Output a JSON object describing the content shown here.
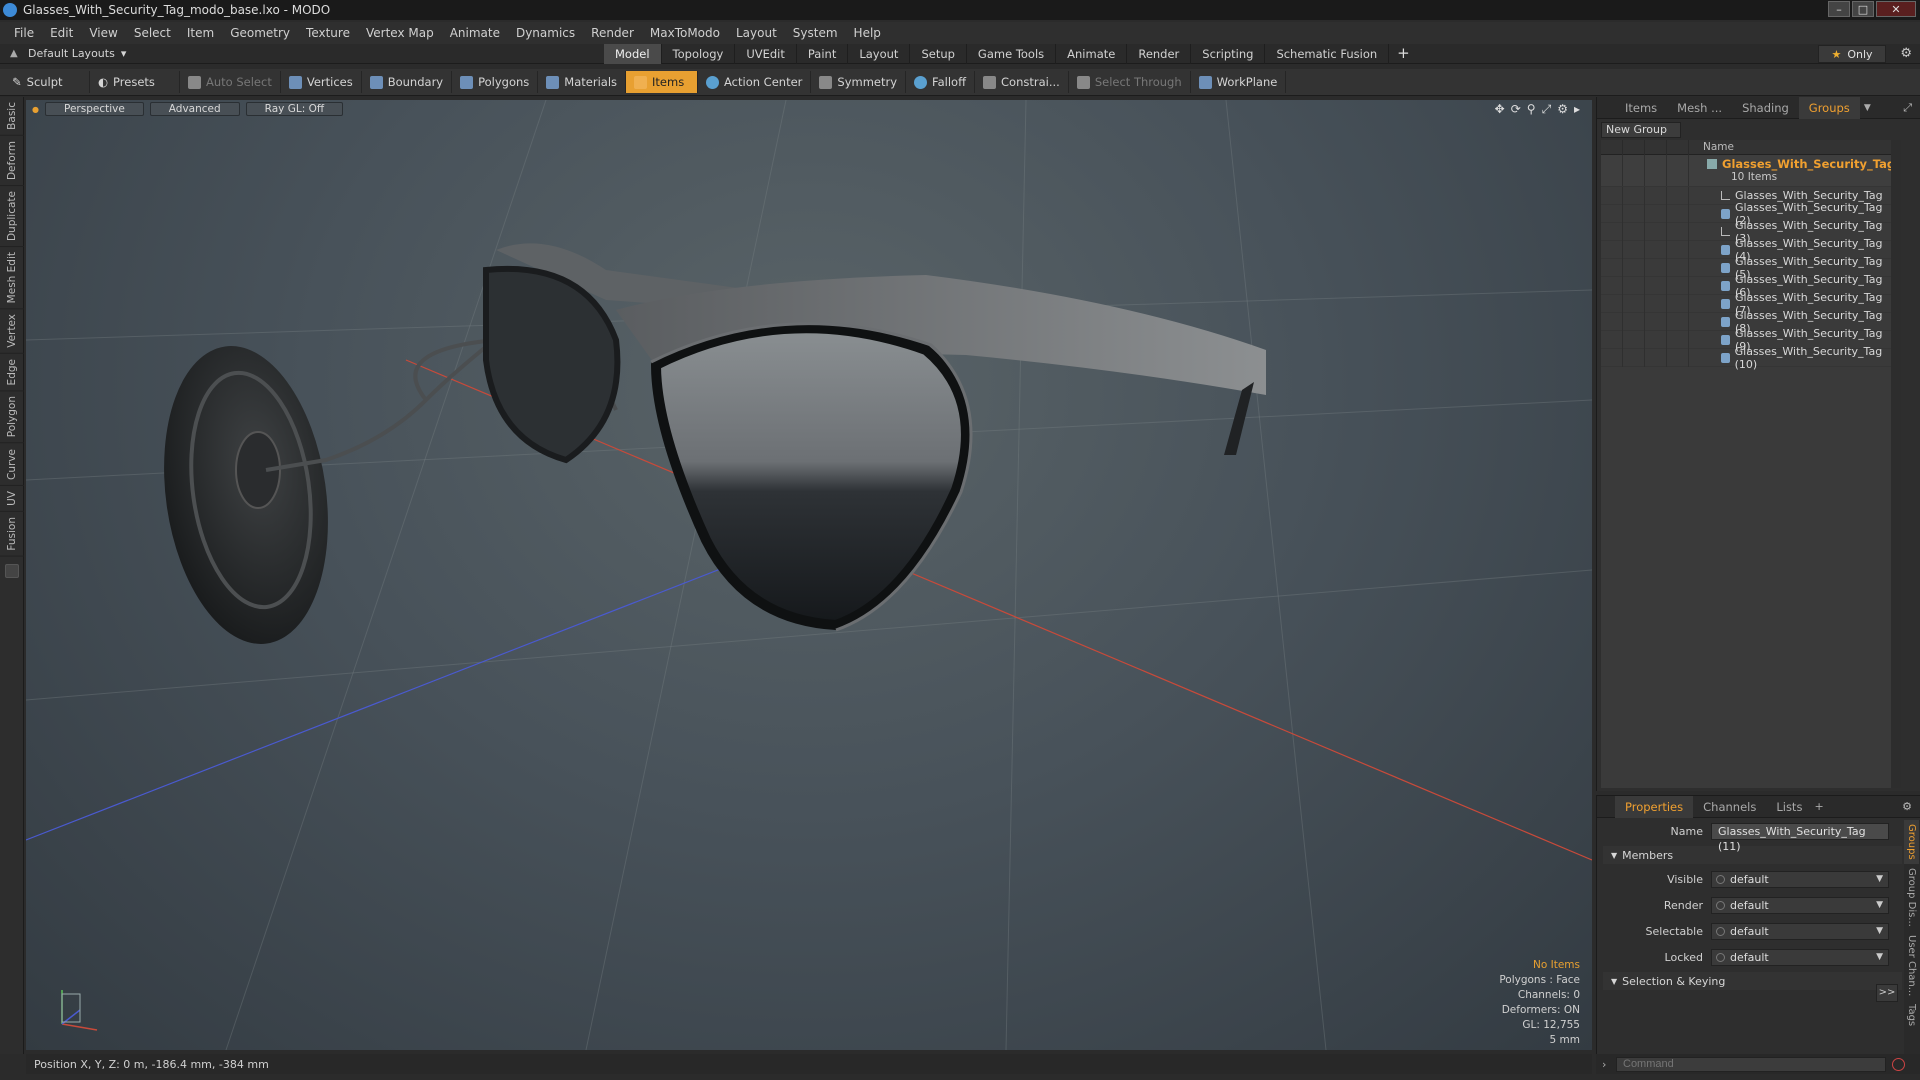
{
  "window": {
    "title": "Glasses_With_Security_Tag_modo_base.lxo - MODO"
  },
  "menu": [
    "File",
    "Edit",
    "View",
    "Select",
    "Item",
    "Geometry",
    "Texture",
    "Vertex Map",
    "Animate",
    "Dynamics",
    "Render",
    "MaxToModo",
    "Layout",
    "System",
    "Help"
  ],
  "layout": {
    "dropdown_label": "Default Layouts",
    "tabs": [
      "Model",
      "Topology",
      "UVEdit",
      "Paint",
      "Layout",
      "Setup",
      "Game Tools",
      "Animate",
      "Render",
      "Scripting",
      "Schematic Fusion"
    ],
    "active_tab": "Model",
    "only_label": "Only"
  },
  "toolbar": {
    "sculpt": "Sculpt",
    "presets": "Presets",
    "auto_select": "Auto Select",
    "vertices": "Vertices",
    "boundary": "Boundary",
    "polygons": "Polygons",
    "materials": "Materials",
    "items": "Items",
    "action_center": "Action Center",
    "symmetry": "Symmetry",
    "falloff": "Falloff",
    "constraints": "Constrai...",
    "select_through": "Select Through",
    "workplane": "WorkPlane"
  },
  "left_tabs": [
    "Basic",
    "Deform",
    "Duplicate",
    "Mesh Edit",
    "Vertex",
    "Edge",
    "Polygon",
    "Curve",
    "UV",
    "Fusion"
  ],
  "viewport": {
    "perspective": "Perspective",
    "advanced": "Advanced",
    "raygl": "Ray GL: Off",
    "hud": {
      "no_items": "No Items",
      "polygons": "Polygons : Face",
      "channels": "Channels: 0",
      "deformers": "Deformers: ON",
      "gl": "GL: 12,755",
      "scale": "5 mm"
    }
  },
  "groups_panel": {
    "tabs": [
      "Items",
      "Mesh ...",
      "Shading",
      "Groups"
    ],
    "active_tab": "Groups",
    "new_group": "New Group",
    "name_header": "Name",
    "group": {
      "name": "Glasses_With_Security_Tag",
      "count": "10 Items"
    },
    "items": [
      {
        "name": "Glasses_With_Security_Tag",
        "icon": "locator"
      },
      {
        "name": "Glasses_With_Security_Tag (2)",
        "icon": "mesh"
      },
      {
        "name": "Glasses_With_Security_Tag (3)",
        "icon": "locator"
      },
      {
        "name": "Glasses_With_Security_Tag (4)",
        "icon": "mesh"
      },
      {
        "name": "Glasses_With_Security_Tag (5)",
        "icon": "mesh"
      },
      {
        "name": "Glasses_With_Security_Tag (6)",
        "icon": "mesh"
      },
      {
        "name": "Glasses_With_Security_Tag (7)",
        "icon": "mesh"
      },
      {
        "name": "Glasses_With_Security_Tag (8)",
        "icon": "mesh"
      },
      {
        "name": "Glasses_With_Security_Tag (9)",
        "icon": "mesh"
      },
      {
        "name": "Glasses_With_Security_Tag (10)",
        "icon": "mesh"
      }
    ]
  },
  "properties": {
    "tabs": [
      "Properties",
      "Channels",
      "Lists"
    ],
    "active_tab": "Properties",
    "name_label": "Name",
    "name_value": "Glasses_With_Security_Tag (11)",
    "members": "Members",
    "visible_label": "Visible",
    "visible_value": "default",
    "render_label": "Render",
    "render_value": "default",
    "selectable_label": "Selectable",
    "selectable_value": "default",
    "locked_label": "Locked",
    "locked_value": "default",
    "selection_keying": "Selection & Keying",
    "more": ">>",
    "side_tabs": [
      "Groups",
      "Group Dis...",
      "User Chan...",
      "Tags"
    ]
  },
  "status": {
    "position": "Position X, Y, Z:  0 m, -186.4 mm, -384 mm",
    "command_placeholder": "Command"
  },
  "colors": {
    "accent": "#e8a031",
    "axis_x": "#c84a3a",
    "axis_z": "#4a5ad0"
  }
}
